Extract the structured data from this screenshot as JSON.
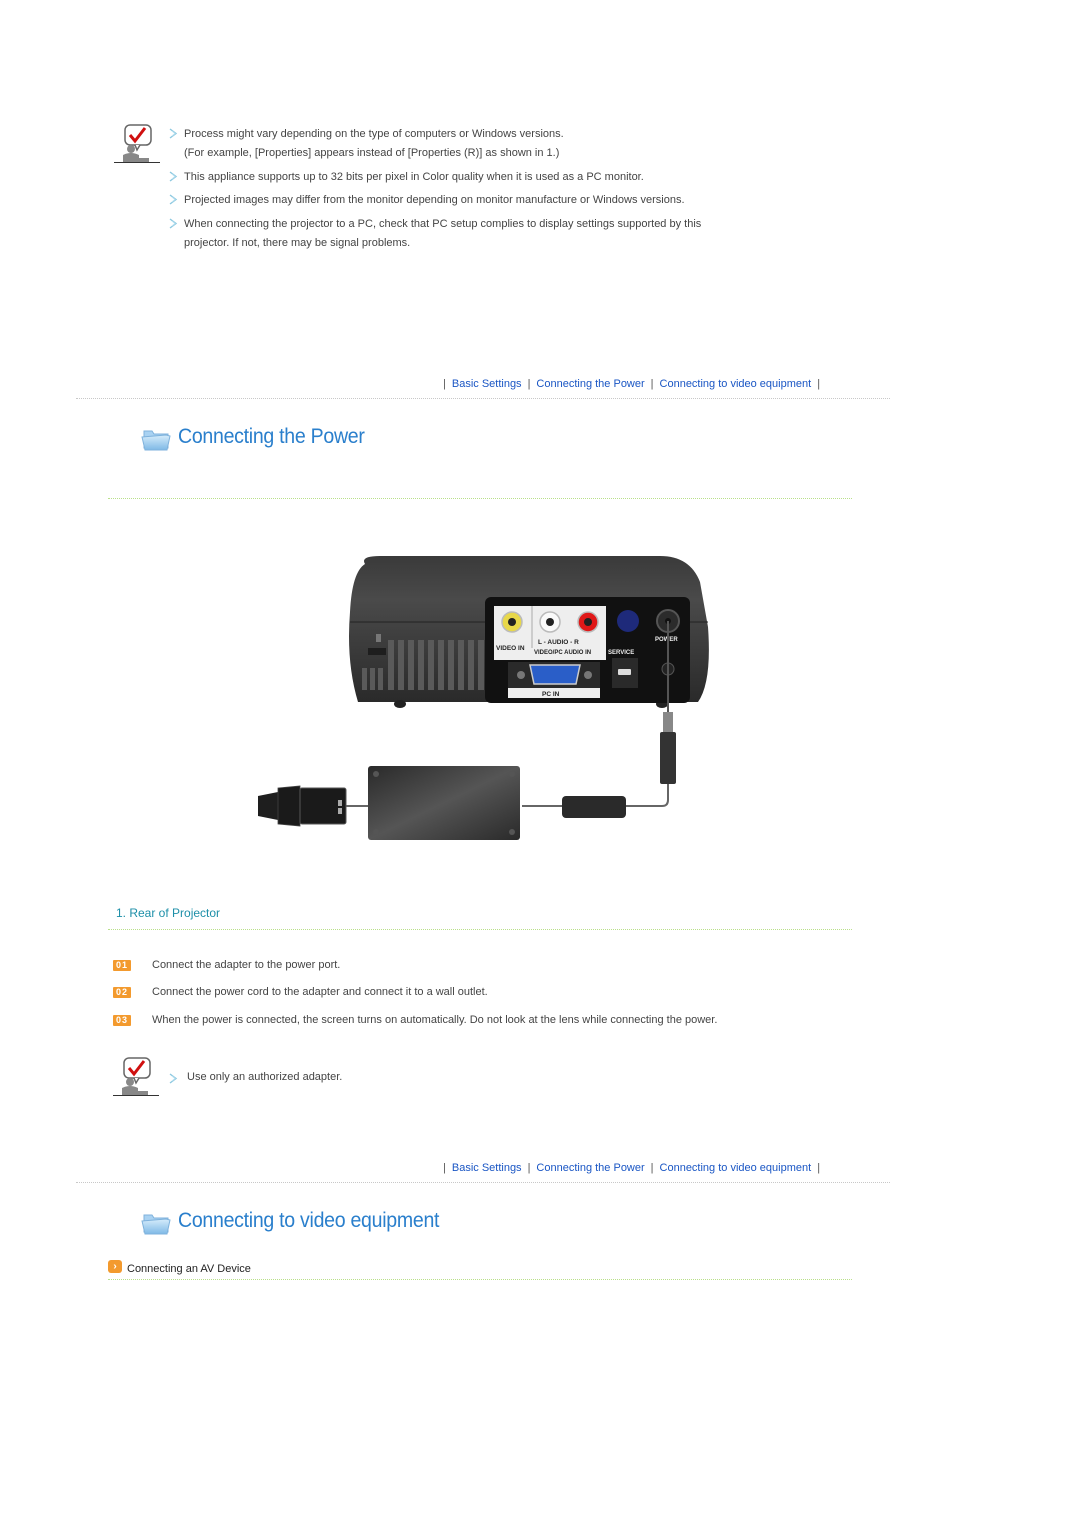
{
  "notes_top": {
    "icon": "note-checkmark-person-icon",
    "items": [
      {
        "lines": [
          "Process might vary depending on the type of computers or Windows versions.",
          "(For example, [Properties] appears instead of [Properties (R)] as shown in 1.)"
        ]
      },
      {
        "lines": [
          "This appliance supports up to 32 bits per pixel in Color quality when it is used as a PC monitor."
        ]
      },
      {
        "lines": [
          "Projected images may differ from the monitor depending on monitor manufacture or Windows versions."
        ]
      },
      {
        "lines": [
          "When connecting the projector to a PC, check that PC setup complies to display settings supported by this",
          "projector. If not, there may be signal problems."
        ]
      }
    ]
  },
  "nav": {
    "separator": "|",
    "links": [
      "Basic Settings",
      "Connecting the Power",
      "Connecting to video equipment"
    ]
  },
  "section_power": {
    "title": "Connecting the Power",
    "icon": "folder-icon",
    "illustration": {
      "labels": {
        "video_in": "VIDEO IN",
        "audio": "L - AUDIO - R",
        "video_pc_audio_in": "VIDEO/PC AUDIO IN",
        "service": "SERVICE",
        "power": "POWER",
        "pc_in": "PC IN"
      }
    },
    "caption": "1. Rear of Projector",
    "steps": [
      {
        "badge": "01",
        "text": "Connect the adapter to the power port."
      },
      {
        "badge": "02",
        "text": "Connect the power cord to the adapter and connect it to a wall outlet."
      },
      {
        "badge": "03",
        "text": "When the power is connected, the screen turns on automatically. Do not look at the lens while connecting the power."
      }
    ],
    "note": "Use only an authorized adapter."
  },
  "section_video": {
    "title": "Connecting to video equipment",
    "icon": "folder-icon",
    "subsection": "Connecting an AV Device"
  },
  "colors": {
    "link": "#1a56c4",
    "title": "#2a7fcc",
    "caption": "#1d8fa8",
    "badge": "#f39a2e"
  }
}
